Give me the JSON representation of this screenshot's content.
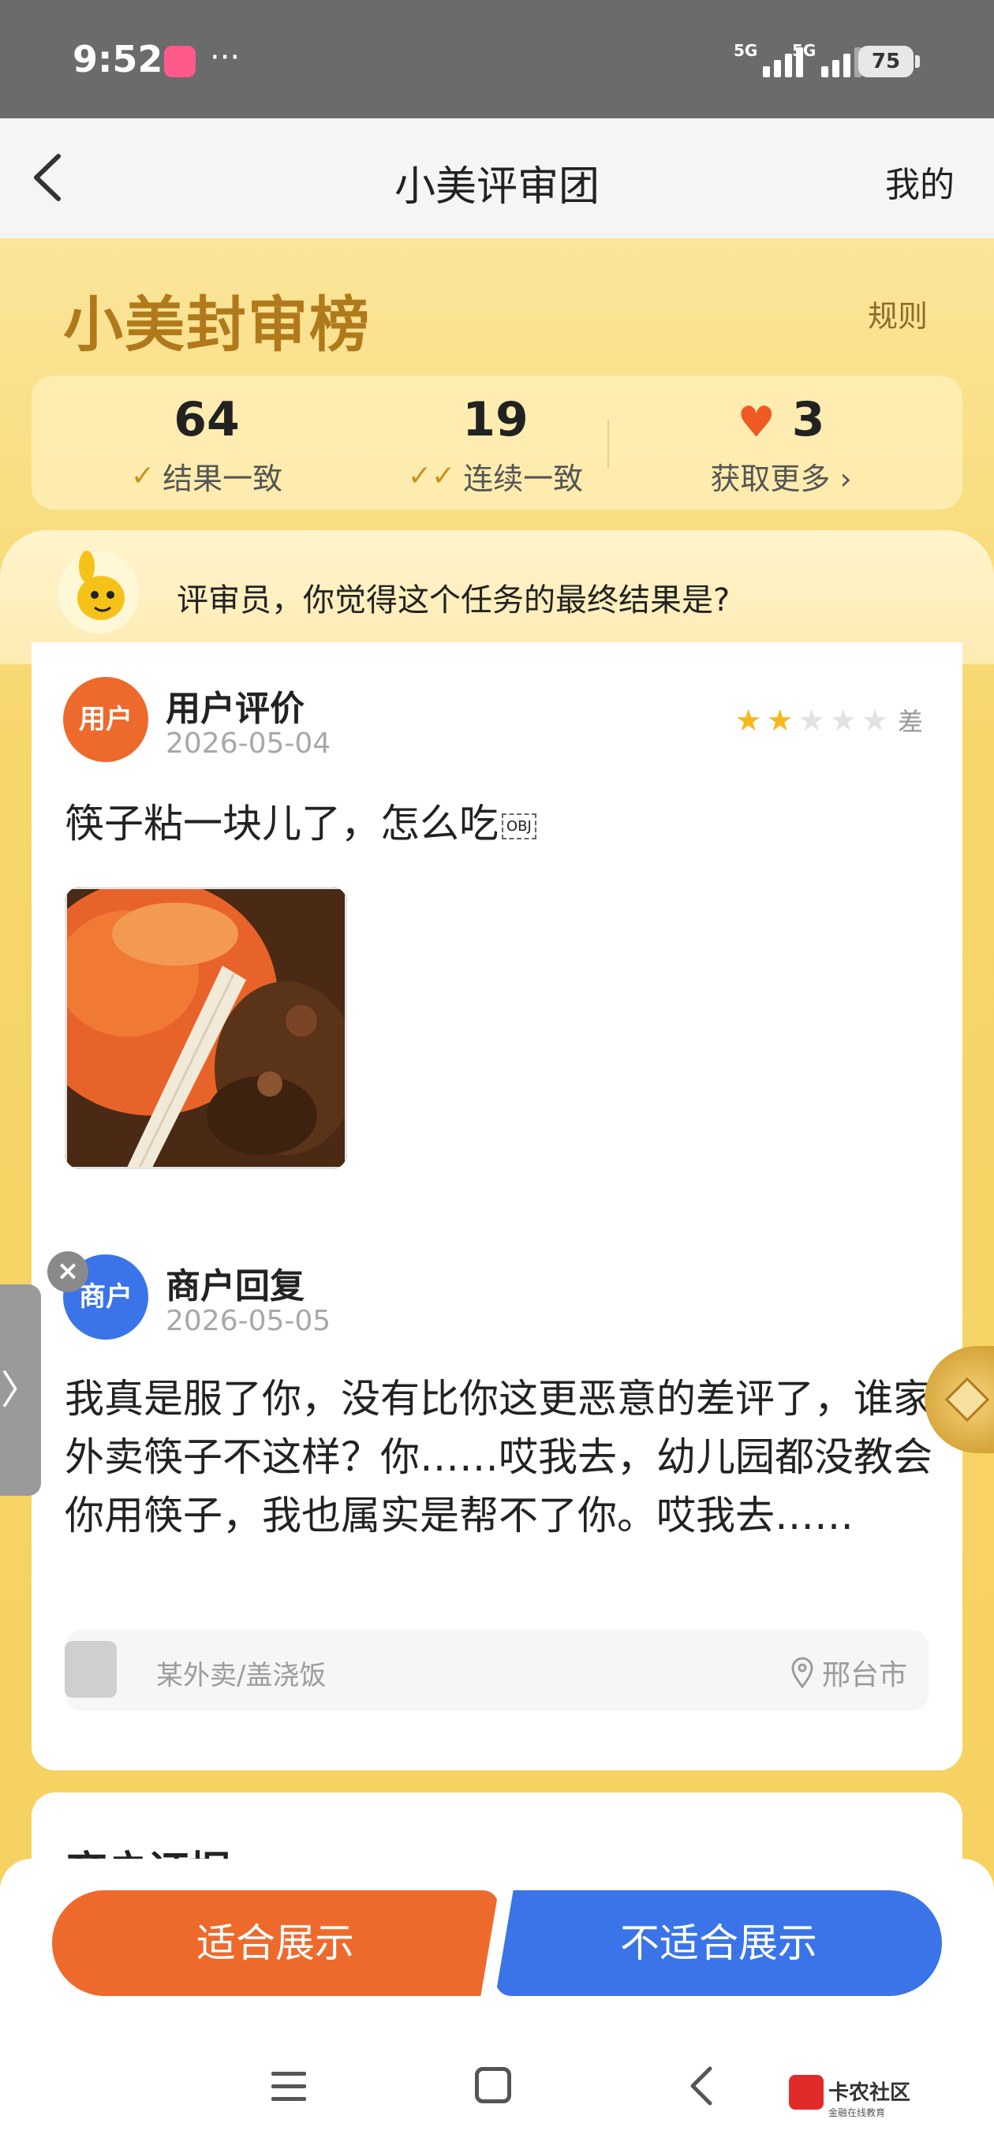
{
  "status_bar": {
    "time": "9:52",
    "more": "···",
    "sim1": "5G",
    "sim2": "5G",
    "battery": "75"
  },
  "nav": {
    "title": "小美评审团",
    "mine": "我的"
  },
  "header": {
    "brand": "小美封审榜",
    "rules": "规则"
  },
  "stats": [
    {
      "value": "64",
      "label": "结果一致"
    },
    {
      "value": "19",
      "label": "连续一致"
    },
    {
      "value": "3",
      "label": "获取更多 ›"
    }
  ],
  "question": "评审员，你觉得这个任务的最终结果是?",
  "user_review": {
    "avatar": "用户",
    "title": "用户评价",
    "date": "2026-05-04",
    "rating": 2,
    "rating_max": 5,
    "rating_label": "差",
    "text": "筷子粘一块儿了，怎么吃",
    "obj": "OBJ"
  },
  "merchant_reply": {
    "avatar": "商户",
    "title": "商户回复",
    "date": "2026-05-05",
    "text": "我真是服了你，没有比你这更恶意的差评了，谁家外卖筷子不这样？你……哎我去，幼儿园都没教会你用筷子，我也属实是帮不了你。哎我去……"
  },
  "info": {
    "shop": "某外卖/盖浇饭",
    "location": "邢台市"
  },
  "card2": {
    "title": "商户证据"
  },
  "actions": {
    "ok": "适合展示",
    "no": "不适合展示"
  },
  "side_tab": "〉",
  "watermark": {
    "name": "卡农社区",
    "sub": "金融在线教育"
  }
}
